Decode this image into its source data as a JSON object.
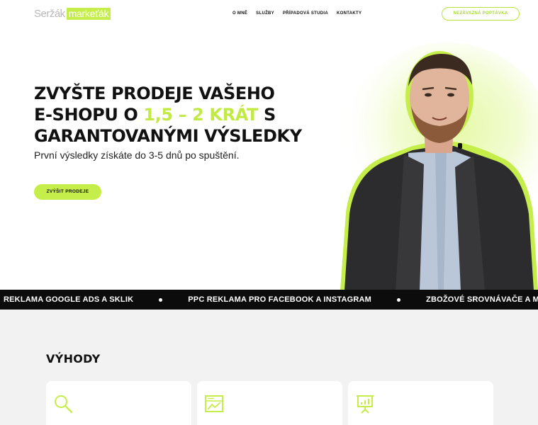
{
  "header": {
    "logo_name": "Seržák",
    "logo_badge": "markeťák",
    "nav": [
      "O MNĚ",
      "SLUŽBY",
      "PŘÍPADOVÁ STUDIA",
      "KONTAKTY"
    ],
    "cta": "NEZÁVAZNÁ POPTÁVKA"
  },
  "hero": {
    "title_line1": "ZVYŠTE PRODEJE VAŠEHO",
    "title_line2_pre": "E-SHOPU O ",
    "title_line2_hl": "1,5 – 2 KRÁT",
    "title_line2_post": " S",
    "title_line3": "GARANTOVANÝMI VÝSLEDKY",
    "subtitle": "První výsledky získáte do 3-5 dnů po spuštění.",
    "button": "ZVÝŠIT PRODEJE"
  },
  "ticker": [
    "REKLAMA GOOGLE ADS A SKLIK",
    "PPC REKLAMA PRO FACEBOOK A INSTAGRAM",
    "ZBOŽOVÉ SROVNÁVAČE A MARKETPLACE"
  ],
  "benefits": {
    "title": "VÝHODY",
    "cards": [
      {
        "icon": "magnifier-icon"
      },
      {
        "icon": "map-chart-icon"
      },
      {
        "icon": "presentation-board-icon"
      }
    ]
  },
  "colors": {
    "accent": "#c6ee4a",
    "dark": "#0c0c0c",
    "section_bg": "#f2f2f2"
  }
}
